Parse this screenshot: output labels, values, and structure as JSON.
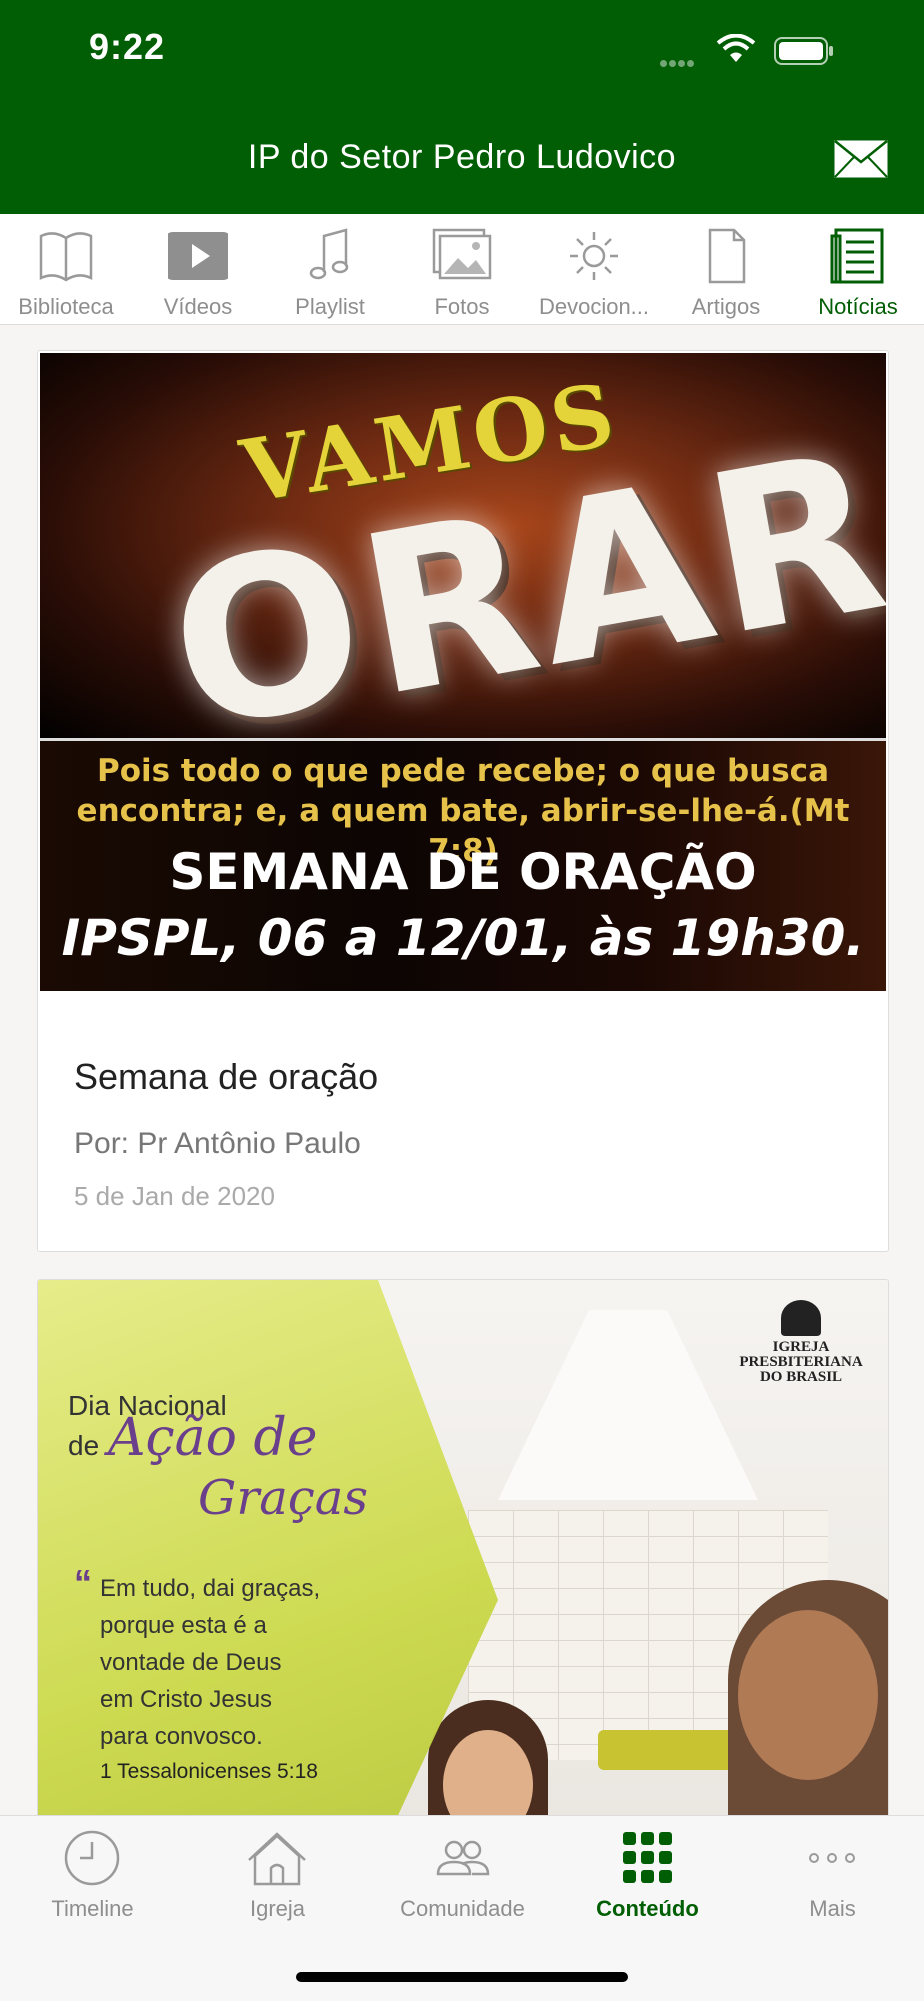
{
  "status": {
    "time": "9:22"
  },
  "header": {
    "title": "IP do Setor Pedro Ludovico",
    "mail_icon": "mail-icon"
  },
  "tabs": [
    {
      "label": "Biblioteca",
      "icon": "book-icon"
    },
    {
      "label": "Vídeos",
      "icon": "play-icon"
    },
    {
      "label": "Playlist",
      "icon": "music-note-icon"
    },
    {
      "label": "Fotos",
      "icon": "photos-icon"
    },
    {
      "label": "Devocion...",
      "icon": "sun-icon"
    },
    {
      "label": "Artigos",
      "icon": "document-icon"
    },
    {
      "label": "Notícias",
      "icon": "newspaper-icon",
      "active": true
    }
  ],
  "posts": [
    {
      "banner": {
        "vamos": "VAMOS",
        "orar": "ORAR",
        "verse_line1": "Pois todo o que pede recebe; o que busca",
        "verse_line2": "encontra; e, a quem bate, abrir-se-lhe-á.(Mt 7:8)",
        "week": "SEMANA DE ORAÇÃO",
        "when": "IPSPL, 06 a 12/01, às 19h30."
      },
      "title": "Semana de oração",
      "author": "Por: Pr Antônio Paulo",
      "date": "5 de Jan de 2020"
    },
    {
      "banner": {
        "logo_line1": "IGREJA",
        "logo_line2": "PRESBITERIANA",
        "logo_line3": "DO BRASIL",
        "heading1": "Dia Nacional",
        "heading2": "de",
        "script1": "Ação de",
        "script2": "Graças",
        "quote_line1": "Em tudo, dai graças,",
        "quote_line2": "porque esta é a",
        "quote_line3": "vontade de Deus",
        "quote_line4": "em Cristo Jesus",
        "quote_line5": "para convosco.",
        "reference": "1 Tessalonicenses 5:18"
      }
    }
  ],
  "bottom_tabs": [
    {
      "label": "Timeline",
      "icon": "clock-icon"
    },
    {
      "label": "Igreja",
      "icon": "church-icon"
    },
    {
      "label": "Comunidade",
      "icon": "people-icon"
    },
    {
      "label": "Conteúdo",
      "icon": "grid-icon",
      "active": true
    },
    {
      "label": "Mais",
      "icon": "more-icon"
    }
  ],
  "colors": {
    "brand": "#015e04",
    "inactive": "#8e8e8e"
  }
}
